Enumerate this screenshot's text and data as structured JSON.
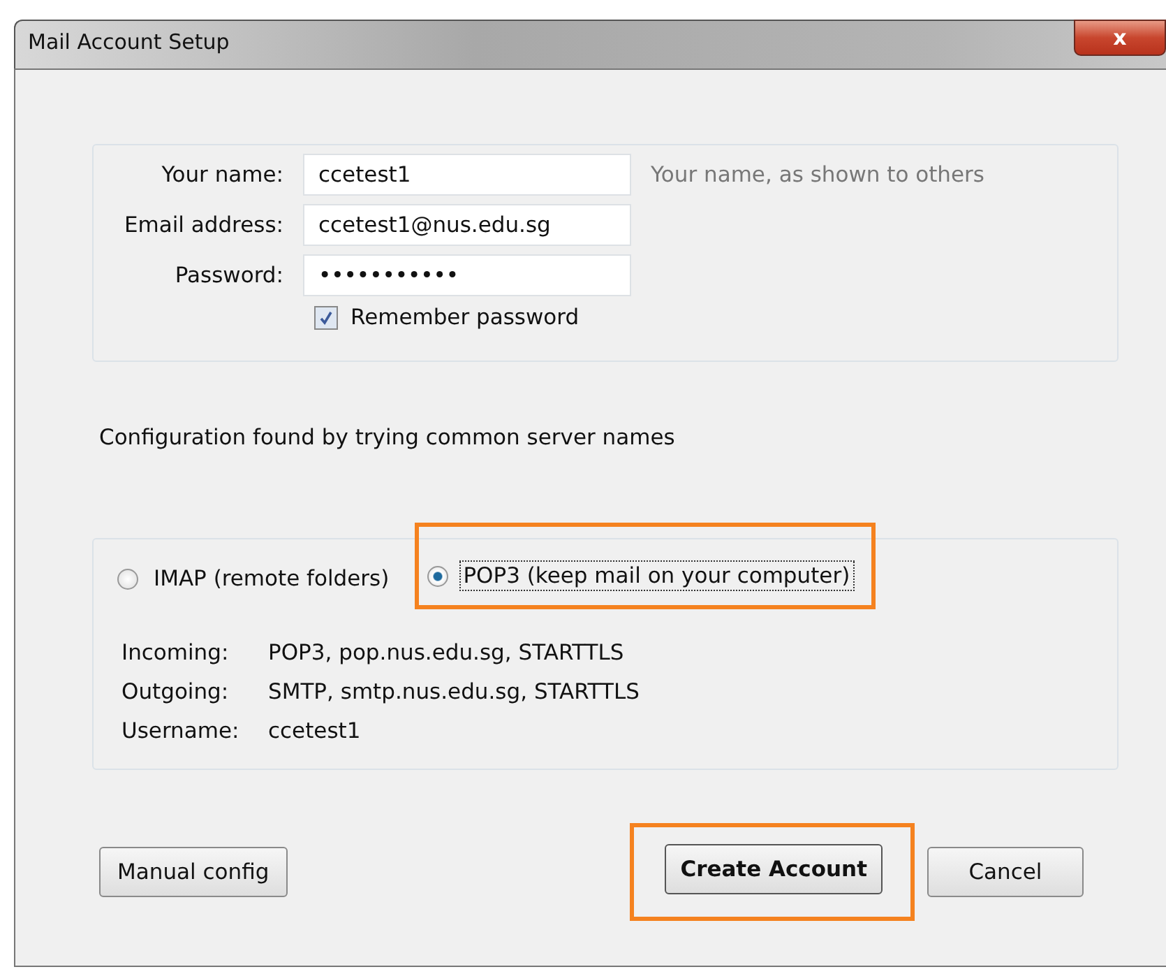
{
  "window": {
    "title": "Mail Account Setup",
    "close_label": "x"
  },
  "form": {
    "fields": [
      {
        "label": "Your name:",
        "value": "ccetest1",
        "hint": "Your name, as shown to others"
      },
      {
        "label": "Email address:",
        "value": "ccetest1@nus.edu.sg"
      },
      {
        "label": "Password:",
        "value": "•••••••••••"
      }
    ],
    "remember": {
      "label": "Remember password",
      "checked": true
    }
  },
  "status": "Configuration found by trying common server names",
  "protocols": [
    {
      "label": "IMAP (remote folders)",
      "selected": false,
      "highlighted": false
    },
    {
      "label": "POP3 (keep mail on your computer)",
      "selected": true,
      "highlighted": true
    }
  ],
  "details": [
    {
      "label": "Incoming:",
      "value": "POP3, pop.nus.edu.sg, STARTTLS"
    },
    {
      "label": "Outgoing:",
      "value": "SMTP, smtp.nus.edu.sg, STARTTLS"
    },
    {
      "label": "Username:",
      "value": "ccetest1"
    }
  ],
  "buttons": [
    {
      "label": "Manual config",
      "kind": "secondary",
      "highlighted": false
    },
    {
      "label": "Create Account",
      "kind": "default",
      "highlighted": true
    },
    {
      "label": "Cancel",
      "kind": "secondary",
      "highlighted": false
    }
  ]
}
